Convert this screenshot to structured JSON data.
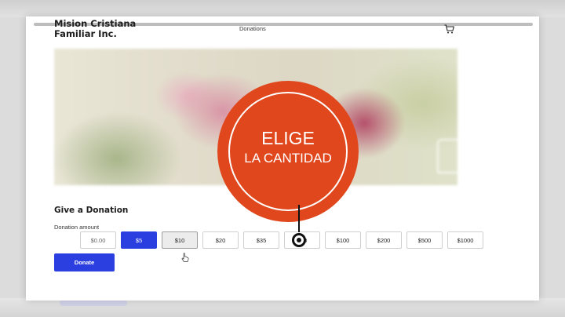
{
  "site": {
    "title": "Mision Cristiana Familiar Inc."
  },
  "nav": {
    "donations_label": "Donations"
  },
  "icons": {
    "cart": "shopping-cart-icon",
    "cursor": "hand-pointer-icon"
  },
  "donation": {
    "section_title": "Give a Donation",
    "amount_label": "Donation amount",
    "custom_amount_value": "$0.00",
    "amounts": [
      "$5",
      "$10",
      "$20",
      "$35",
      "$50",
      "$100",
      "$200",
      "$500",
      "$1000"
    ],
    "selected_amount": "$5",
    "hovered_amount": "$10",
    "donate_label": "Donate"
  },
  "overlay": {
    "line1": "ELIGE",
    "line2": "LA CANTIDAD"
  },
  "colors": {
    "accent_blue": "#2b3fe0",
    "badge_orange": "#e1471d",
    "hero_rose": "#d995a6"
  }
}
